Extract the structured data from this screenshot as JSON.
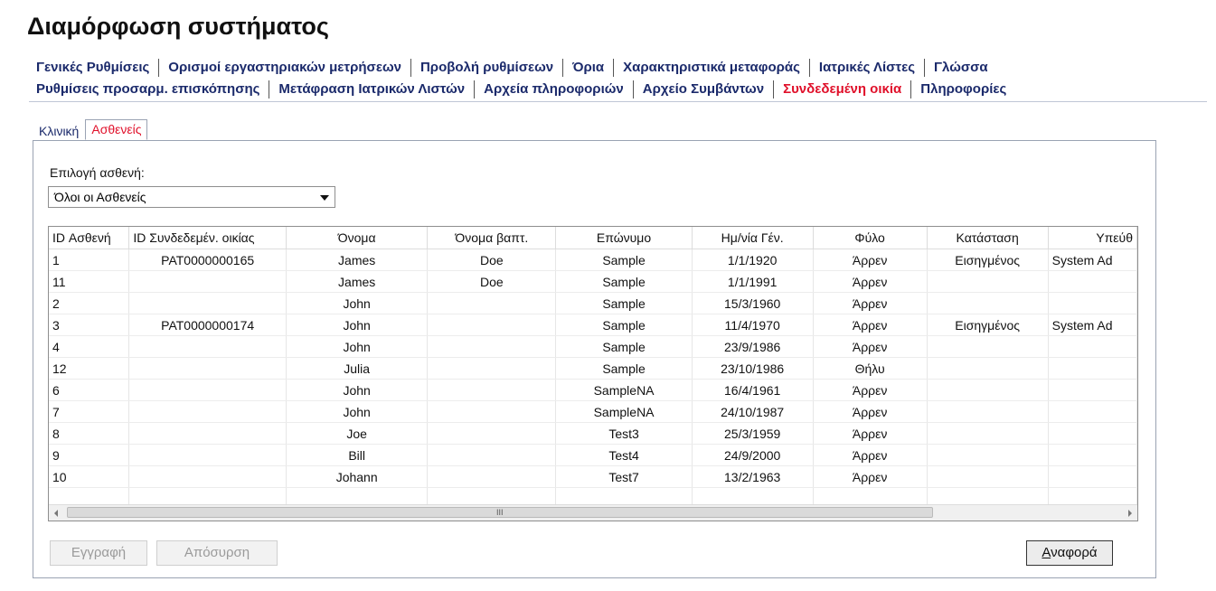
{
  "page_title": "Διαμόρφωση συστήματος",
  "tabs_row1": [
    "Γενικές Ρυθμίσεις",
    "Ορισμοί εργαστηριακών μετρήσεων",
    "Προβολή ρυθμίσεων",
    "Όρια",
    "Χαρακτηριστικά μεταφοράς",
    "Ιατρικές Λίστες",
    "Γλώσσα"
  ],
  "tabs_row2": [
    "Ρυθμίσεις προσαρμ. επισκόπησης",
    "Μετάφραση Ιατρικών Λιστών",
    "Αρχεία πληροφοριών",
    "Αρχείο Συμβάντων",
    "Συνδεδεμένη οικία",
    "Πληροφορίες"
  ],
  "active_tab": "Συνδεδεμένη οικία",
  "subtabs": [
    "Κλινική",
    "Ασθενείς"
  ],
  "active_subtab": "Ασθενείς",
  "patient_select": {
    "label": "Επιλογή ασθενή:",
    "value": "Όλοι οι Ασθενείς"
  },
  "table": {
    "columns": [
      "ID Ασθενή",
      "ID Συνδεδεμέν. οικίας",
      "Όνομα",
      "Όνομα βαπτ.",
      "Επώνυμο",
      "Ημ/νία Γέν.",
      "Φύλο",
      "Κατάσταση",
      "Υπεύθ"
    ],
    "rows": [
      [
        "1",
        "PAT0000000165",
        "James",
        "Doe",
        "Sample",
        "1/1/1920",
        "Άρρεν",
        "Εισηγμένος",
        "System Ad"
      ],
      [
        "11",
        "",
        "James",
        "Doe",
        "Sample",
        "1/1/1991",
        "Άρρεν",
        "",
        ""
      ],
      [
        "2",
        "",
        "John",
        "",
        "Sample",
        "15/3/1960",
        "Άρρεν",
        "",
        ""
      ],
      [
        "3",
        "PAT0000000174",
        "John",
        "",
        "Sample",
        "11/4/1970",
        "Άρρεν",
        "Εισηγμένος",
        "System Ad"
      ],
      [
        "4",
        "",
        "John",
        "",
        "Sample",
        "23/9/1986",
        "Άρρεν",
        "",
        ""
      ],
      [
        "12",
        "",
        "Julia",
        "",
        "Sample",
        "23/10/1986",
        "Θήλυ",
        "",
        ""
      ],
      [
        "6",
        "",
        "John",
        "",
        "SampleNA",
        "16/4/1961",
        "Άρρεν",
        "",
        ""
      ],
      [
        "7",
        "",
        "John",
        "",
        "SampleNA",
        "24/10/1987",
        "Άρρεν",
        "",
        ""
      ],
      [
        "8",
        "",
        "Joe",
        "",
        "Test3",
        "25/3/1959",
        "Άρρεν",
        "",
        ""
      ],
      [
        "9",
        "",
        "Bill",
        "",
        "Test4",
        "24/9/2000",
        "Άρρεν",
        "",
        ""
      ],
      [
        "10",
        "",
        "Johann",
        "",
        "Test7",
        "13/2/1963",
        "Άρρεν",
        "",
        ""
      ]
    ]
  },
  "scrollbar_grip": "III",
  "buttons": {
    "register": "Εγγραφή",
    "withdraw": "Απόσυρση",
    "report_first": "Α",
    "report_rest": "ναφορά"
  },
  "colors": {
    "tab_text": "#1b2a6b",
    "active": "#e0102a"
  }
}
